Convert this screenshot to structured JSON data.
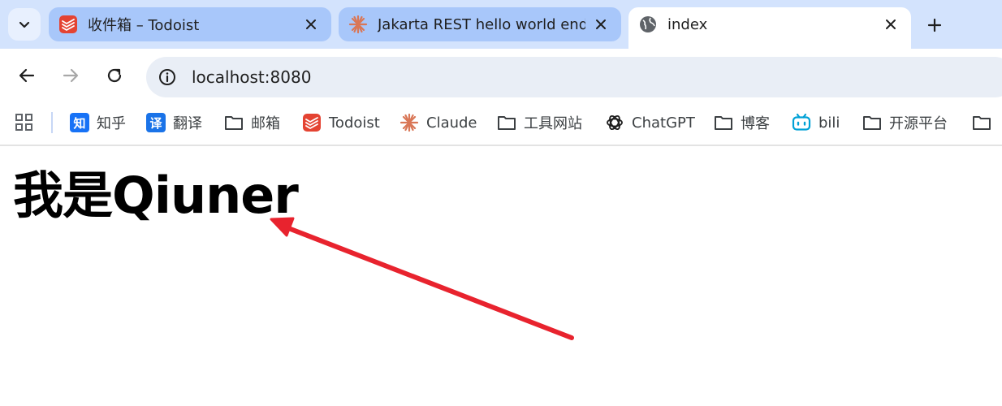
{
  "tabs": [
    {
      "title": "收件箱 – Todoist",
      "favicon": "todoist-icon",
      "active": false
    },
    {
      "title": "Jakarta REST hello world endpoint",
      "favicon": "claude-icon",
      "active": false
    },
    {
      "title": "index",
      "favicon": "globe-icon",
      "active": true
    }
  ],
  "omnibox": {
    "url": "localhost:8080"
  },
  "bookmarks": [
    {
      "label": "知乎",
      "icon": "zhihu-icon",
      "badge": "知"
    },
    {
      "label": "翻译",
      "icon": "translate-icon",
      "badge": "译"
    },
    {
      "label": "邮箱",
      "icon": "folder-icon"
    },
    {
      "label": "Todoist",
      "icon": "todoist-icon"
    },
    {
      "label": "Claude",
      "icon": "claude-icon"
    },
    {
      "label": "工具网站",
      "icon": "folder-icon"
    },
    {
      "label": "ChatGPT",
      "icon": "chatgpt-icon"
    },
    {
      "label": "博客",
      "icon": "folder-icon"
    },
    {
      "label": "bili",
      "icon": "bilibili-icon"
    },
    {
      "label": "开源平台",
      "icon": "folder-icon"
    }
  ],
  "page": {
    "heading": "我是Qiuner"
  },
  "colors": {
    "tabstrip": "#d3e3fd",
    "inactive_tab": "#a8c7fa",
    "annotation_arrow": "#e8232e",
    "todoist": "#e44332",
    "claude": "#d97757",
    "zhihu": "#1772f6",
    "bili": "#00a1d6"
  }
}
